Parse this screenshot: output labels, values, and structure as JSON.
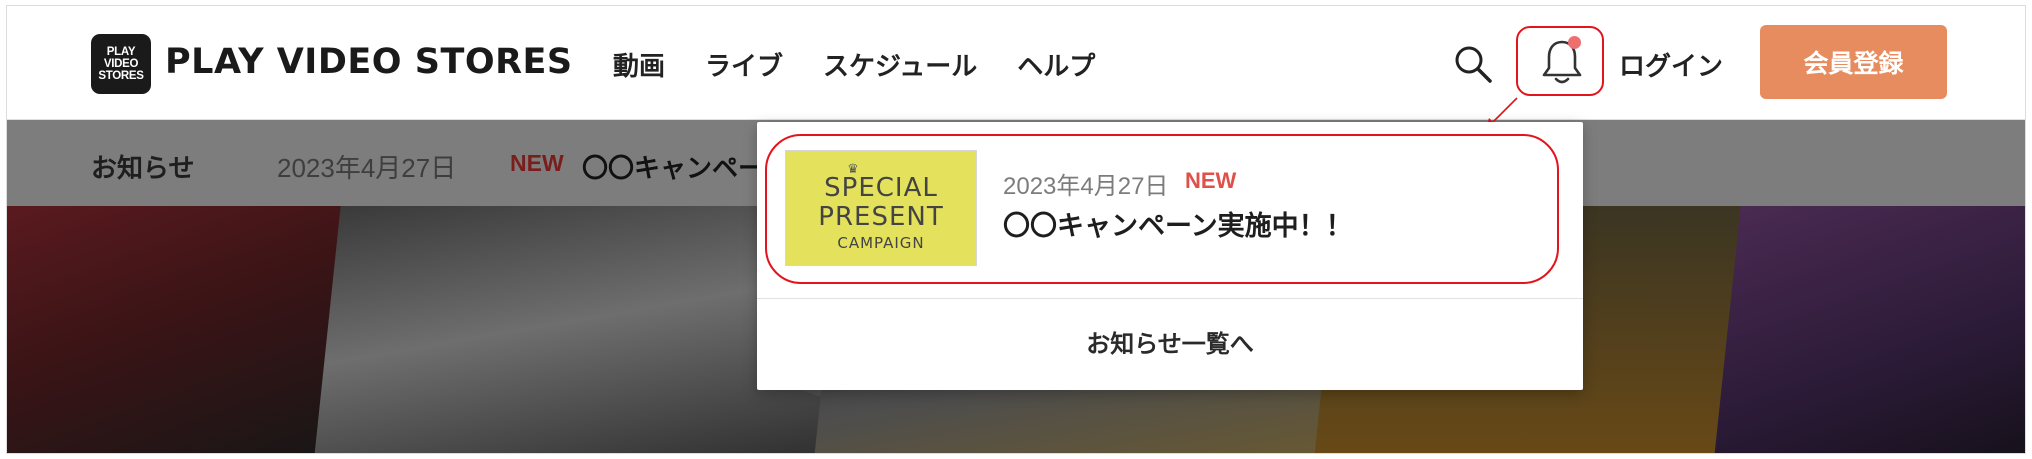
{
  "header": {
    "logo_lines": [
      "PLAY",
      "VIDEO",
      "STORES"
    ],
    "brand": "PLAY VIDEO STORES",
    "nav": [
      "動画",
      "ライブ",
      "スケジュール",
      "ヘルプ"
    ],
    "login": "ログイン",
    "register": "会員登録",
    "accent_color": "#e78c5f",
    "icons": [
      "search-icon",
      "bell-icon"
    ]
  },
  "news_bar": {
    "label": "お知らせ",
    "date": "2023年4月27日",
    "badge": "NEW",
    "title": "〇〇キャンペー"
  },
  "notifications": {
    "items": [
      {
        "thumb": {
          "line1": "SPECIAL",
          "line2": "PRESENT",
          "line3": "CAMPAIGN"
        },
        "date": "2023年4月27日",
        "badge": "NEW",
        "title": "〇〇キャンペーン実施中！！"
      }
    ],
    "footer_link": "お知らせ一覧へ",
    "highlight_color": "#e3141b"
  }
}
